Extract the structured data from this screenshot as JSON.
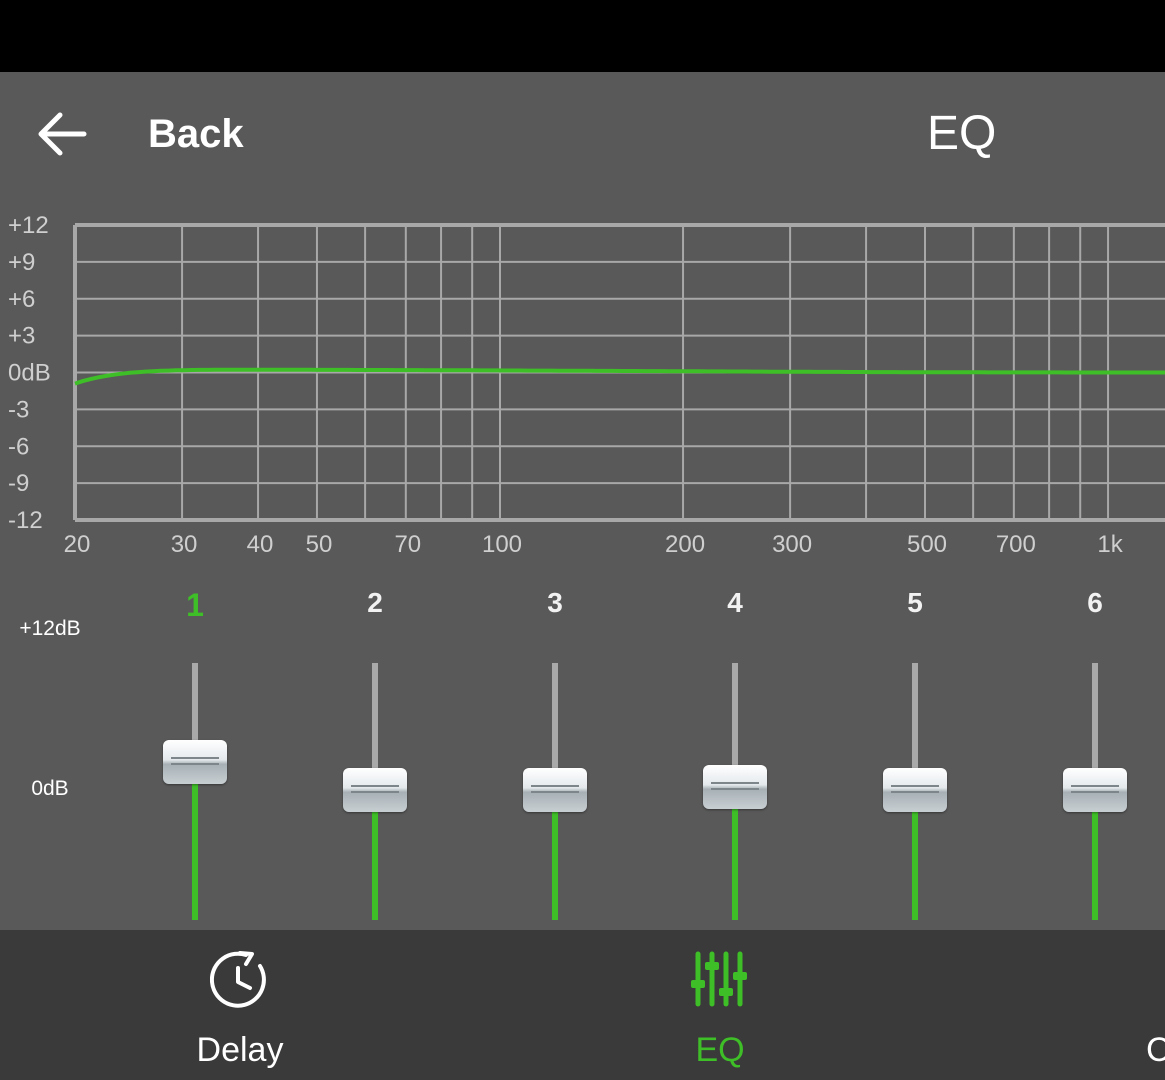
{
  "header": {
    "back_label": "Back",
    "title": "EQ"
  },
  "graph": {
    "y_labels": [
      "+12",
      "+9",
      "+6",
      "+3",
      "0dB",
      "-3",
      "-6",
      "-9",
      "-12"
    ],
    "x_labels": [
      "20",
      "30",
      "40",
      "50",
      "70",
      "100",
      "200",
      "300",
      "500",
      "700",
      "1k"
    ],
    "grid_color": "#a8a8a8",
    "curve_color": "#3fbf27"
  },
  "sliders": {
    "top_label": "+12dB",
    "zero_label": "0dB",
    "bands": [
      {
        "label": "1",
        "active": true,
        "gain_db": 2.6
      },
      {
        "label": "2",
        "active": false,
        "gain_db": 0
      },
      {
        "label": "3",
        "active": false,
        "gain_db": 0
      },
      {
        "label": "4",
        "active": false,
        "gain_db": 0.3
      },
      {
        "label": "5",
        "active": false,
        "gain_db": 0
      },
      {
        "label": "6",
        "active": false,
        "gain_db": 0
      }
    ]
  },
  "nav": {
    "delay_label": "Delay",
    "eq_label": "EQ",
    "partial_label": "C",
    "active_color": "#3fbf27"
  }
}
